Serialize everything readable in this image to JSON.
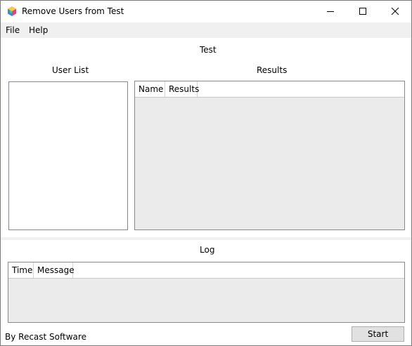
{
  "window": {
    "title": "Remove Users from Test",
    "app_icon": "colorful-cube-icon",
    "caption_buttons": [
      "minimize-icon",
      "maximize-icon",
      "close-icon"
    ]
  },
  "menu": {
    "items": [
      {
        "label": "File"
      },
      {
        "label": "Help"
      }
    ]
  },
  "main": {
    "heading": "Test",
    "user_list": {
      "label": "User List"
    },
    "results": {
      "label": "Results",
      "columns": [
        "Name",
        "Results"
      ]
    }
  },
  "log": {
    "label": "Log",
    "columns": [
      "Time",
      "Message"
    ]
  },
  "footer": {
    "credit": "By Recast Software",
    "start_label": "Start"
  },
  "colors": {
    "grid_border": "#6d8fb3",
    "grid_background": "#ebebeb",
    "menubar_background": "#f0f0f0",
    "button_background": "#e1e1e1"
  }
}
